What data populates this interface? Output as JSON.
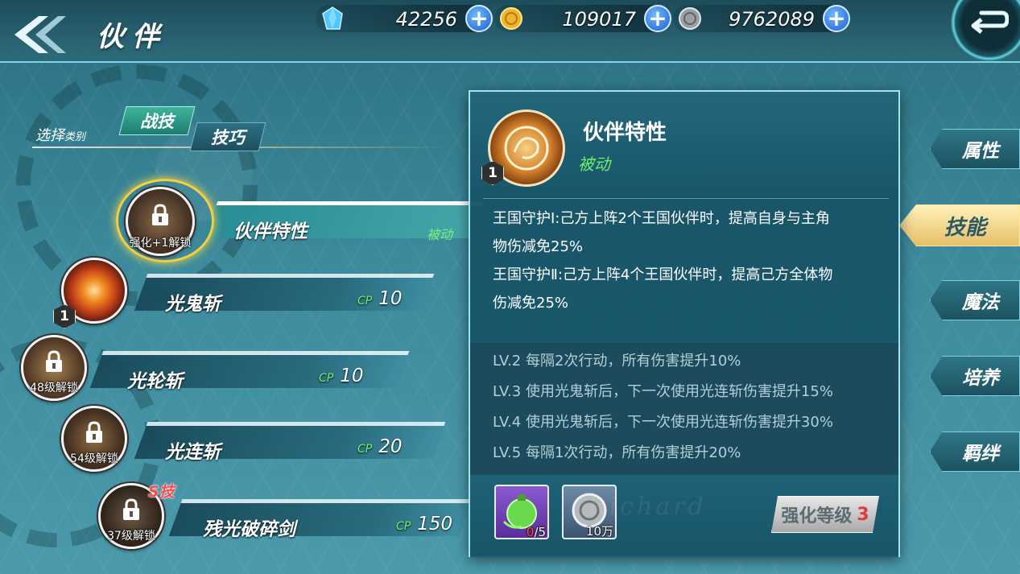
{
  "header": {
    "title": "伙伴",
    "currencies": [
      {
        "icon": "blue-gem-icon",
        "value": "42256"
      },
      {
        "icon": "gold-coin-icon",
        "value": "109017"
      },
      {
        "icon": "silver-coin-icon",
        "value": "9762089"
      }
    ]
  },
  "category": {
    "label": "选择",
    "label_small": "类别",
    "tabs": [
      {
        "label": "战技",
        "active": true
      },
      {
        "label": "技巧",
        "active": false
      }
    ]
  },
  "skills": [
    {
      "name": "伙伴特性",
      "tag": "被动",
      "lock_text": "强化+1解锁",
      "selected": true
    },
    {
      "name": "光鬼斩",
      "cp_label": "CP",
      "cp": "10",
      "level": "1"
    },
    {
      "name": "光轮斩",
      "cp_label": "CP",
      "cp": "10",
      "lock_text": "48级解锁"
    },
    {
      "name": "光连斩",
      "cp_label": "CP",
      "cp": "20",
      "lock_text": "54级解锁"
    },
    {
      "name": "残光破碎剑",
      "cp_label": "CP",
      "cp": "150",
      "lock_text": "37级解锁",
      "special": "S技"
    }
  ],
  "side_menu": [
    {
      "label": "属性",
      "active": false
    },
    {
      "label": "技能",
      "active": true
    },
    {
      "label": "魔法",
      "active": false
    },
    {
      "label": "培养",
      "active": false
    },
    {
      "label": "羁绊",
      "active": false
    }
  ],
  "detail": {
    "title": "伙伴特性",
    "type": "被动",
    "level": "1",
    "description": [
      "王国守护Ⅰ:己方上阵2个王国伙伴时，提高自身与主角",
      "物伤减免25%",
      "王国守护Ⅱ:己方上阵4个王国伙伴时，提高己方全体物",
      "伤减免25%"
    ],
    "upgrades": [
      "LV.2  每隔2次行动，所有伤害提升10%",
      "LV.3  使用光鬼斩后，下一次使用光连斩伤害提升15%",
      "LV.4  使用光鬼斩后，下一次使用光连斩伤害提升30%",
      "LV.5  每隔1次行动，所有伤害提升20%"
    ],
    "costs": [
      {
        "icon": "green-potion-icon",
        "have": "0",
        "need": "/5"
      },
      {
        "icon": "silver-coin-icon",
        "amount": "10万"
      }
    ],
    "enhance_label": "强化等级",
    "enhance_level": "3",
    "watermark": "Richard"
  },
  "colors": {
    "accent": "#7fd4e6",
    "passive_green": "#6ff06b",
    "highlight_gold": "#f7cf3d",
    "warning_red": "#e03a3a"
  }
}
